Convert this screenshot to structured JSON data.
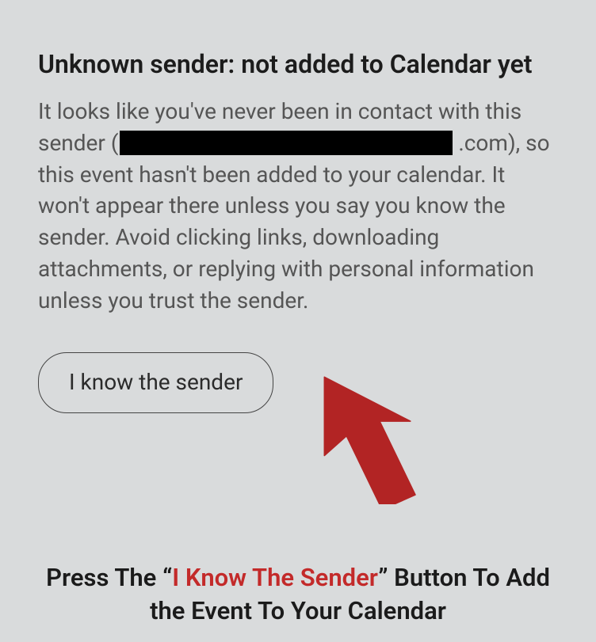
{
  "heading": "Unknown sender: not added to Calendar yet",
  "body": {
    "pre": "It looks like you've never been in contact with this sender (",
    "post": ".com), so this event hasn't been added to your calendar. It won't appear there unless you say you know the sender. Avoid clicking links, downloading attachments, or replying with personal information unless you trust the sender."
  },
  "button_label": "I know the sender",
  "caption": {
    "pre": "Press The “",
    "highlight": "I Know The Sender",
    "post": "” Button To Add the Event To Your Calendar"
  }
}
